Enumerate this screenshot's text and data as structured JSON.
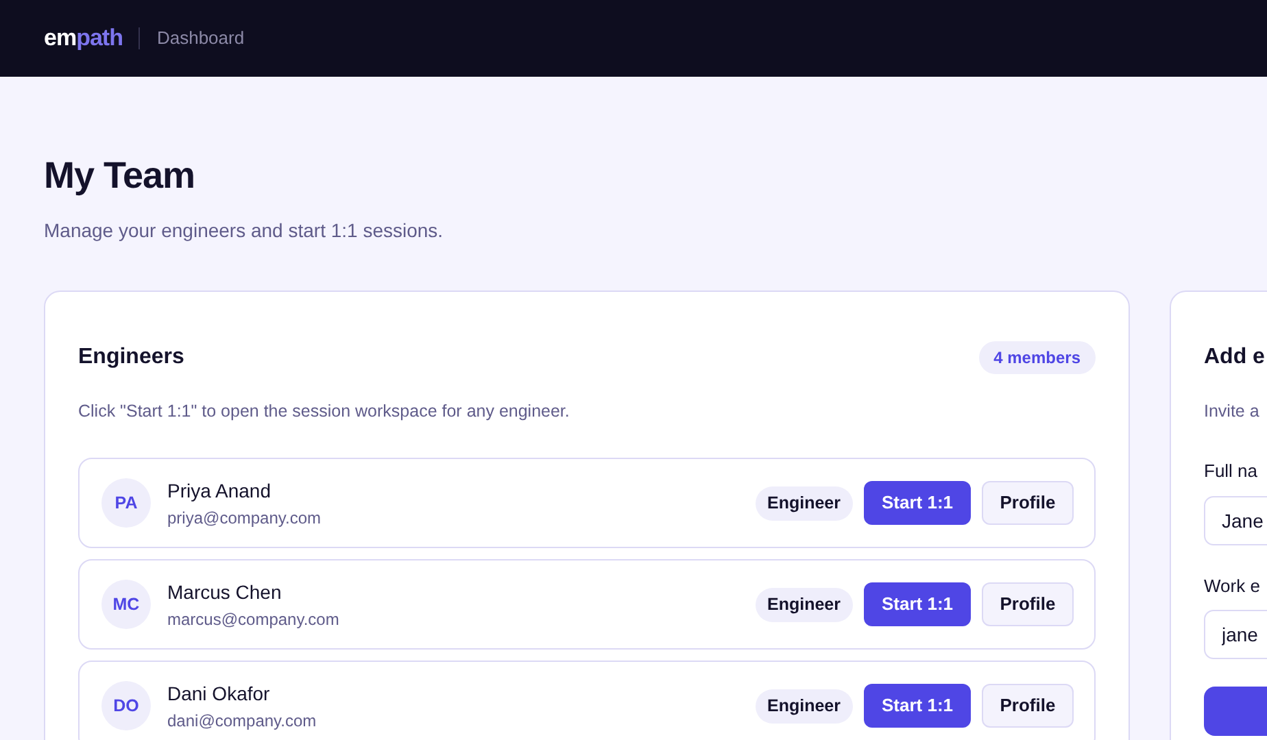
{
  "navbar": {
    "logo": {
      "main": "em",
      "accent": "path"
    },
    "section": "Dashboard"
  },
  "header": {
    "title": "My Team",
    "subtitle": "Manage your engineers and start 1:1 sessions."
  },
  "engineers": {
    "title": "Engineers",
    "count": "4 members",
    "hint": "Click \"Start 1:1\" to open the session workspace for any engineer.",
    "rows": [
      {
        "initials": "PA",
        "name": "Priya Anand",
        "email": "priya@company.com",
        "role": "Engineer",
        "start": "Start 1:1",
        "profile": "Profile"
      },
      {
        "initials": "MC",
        "name": "Marcus Chen",
        "email": "marcus@company.com",
        "role": "Engineer",
        "start": "Start 1:1",
        "profile": "Profile"
      },
      {
        "initials": "DO",
        "name": "Dani Okafor",
        "email": "dani@company.com",
        "role": "Engineer",
        "start": "Start 1:1",
        "profile": "Profile"
      }
    ]
  },
  "add_panel": {
    "title": "Add e",
    "hint": "Invite a",
    "fields": [
      {
        "label": "Full na",
        "value": "Jane"
      },
      {
        "label": "Work e",
        "value": "jane"
      }
    ]
  }
}
